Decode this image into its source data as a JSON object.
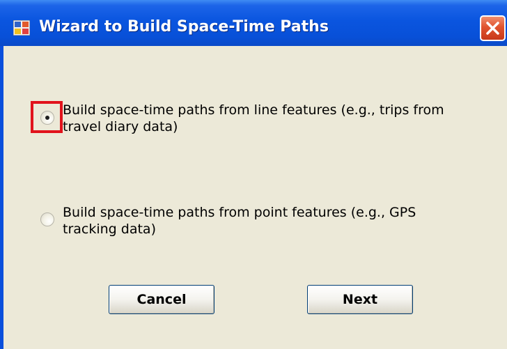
{
  "window": {
    "title": "Wizard to Build Space-Time Paths",
    "close_icon": "close-icon",
    "app_icon": "application-icon"
  },
  "options": [
    {
      "label_line1": "Build space-time paths from line features (e.g., trips from",
      "label_line2": "travel diary data)",
      "selected": true
    },
    {
      "label_line1": "Build space-time paths from point features (e.g., GPS",
      "label_line2": "tracking data)",
      "selected": false
    }
  ],
  "buttons": {
    "cancel_label": "Cancel",
    "next_label": "Next"
  },
  "colors": {
    "titlebar": "#0a55df",
    "client_bg": "#ece9d8",
    "close_button": "#e0532e",
    "highlight_box": "#e1131c"
  }
}
